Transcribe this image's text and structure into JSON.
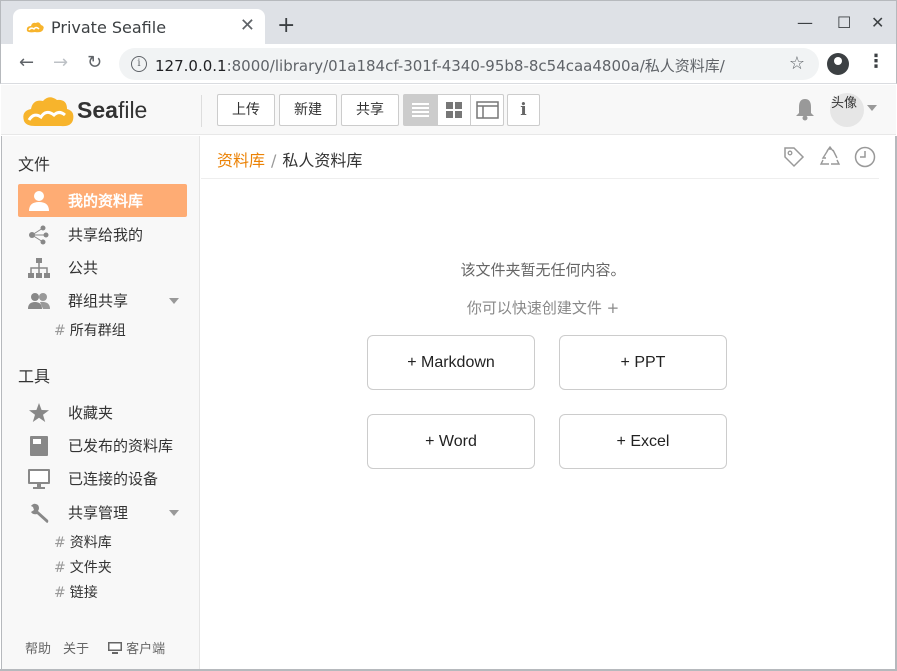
{
  "browser": {
    "tab_title": "Private Seafile",
    "tab_close": "✕",
    "new_tab": "+",
    "minimize": "—",
    "maximize": "☐",
    "close": "✕",
    "back": "←",
    "forward": "→",
    "reload": "↻",
    "url_host": "127.0.0.1",
    "url_rest": ":8000/library/01a184cf-301f-4340-95b8-8c54caa4800a/私人资料库/",
    "bookmark": "☆",
    "menu": "⋮"
  },
  "header": {
    "logo_sea": "Sea",
    "logo_file": "file",
    "upload_label": "上传",
    "new_label": "新建",
    "share_label": "共享",
    "avatar_alt": "头像"
  },
  "sidebar": {
    "files_heading": "文件",
    "tools_heading": "工具",
    "items": [
      {
        "label": "我的资料库",
        "icon": "user-icon",
        "active": true
      },
      {
        "label": "共享给我的",
        "icon": "share-nodes-icon"
      },
      {
        "label": "公共",
        "icon": "sitemap-icon"
      },
      {
        "label": "群组共享",
        "icon": "group-icon"
      }
    ],
    "group_sub": "所有群组",
    "tools": [
      {
        "label": "收藏夹",
        "icon": "star-icon"
      },
      {
        "label": "已发布的资料库",
        "icon": "book-icon"
      },
      {
        "label": "已连接的设备",
        "icon": "monitor-icon"
      },
      {
        "label": "共享管理",
        "icon": "wrench-icon"
      }
    ],
    "share_subs": [
      "资料库",
      "文件夹",
      "链接"
    ],
    "hash": "#",
    "footer": {
      "help": "帮助",
      "about": "关于",
      "client": "客户端"
    }
  },
  "main": {
    "breadcrumb_root": "资料库",
    "breadcrumb_sep": "/",
    "breadcrumb_current": "私人资料库",
    "empty_title": "该文件夹暂无任何内容。",
    "empty_hint": "你可以快速创建文件 +",
    "create_buttons": [
      "+ Markdown",
      "+ PPT",
      "+ Word",
      "+ Excel"
    ]
  },
  "colors": {
    "accent": "#feac74",
    "link": "#eb8205",
    "logo": "#f7b42c"
  }
}
